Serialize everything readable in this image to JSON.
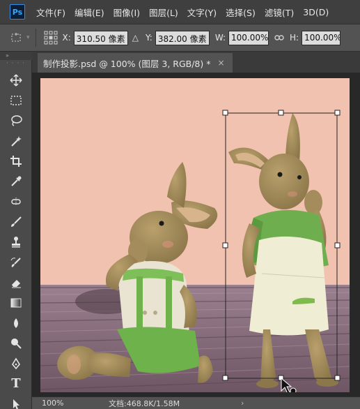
{
  "app": {
    "logo": "Ps"
  },
  "menu": [
    "文件(F)",
    "编辑(E)",
    "图像(I)",
    "图层(L)",
    "文字(Y)",
    "选择(S)",
    "滤镜(T)",
    "3D(D)"
  ],
  "options": {
    "x_label": "X:",
    "x_value": "310.50 像素",
    "delta_icon": "△",
    "y_label": "Y:",
    "y_value": "382.00 像素",
    "w_label": "W:",
    "w_value": "100.00%",
    "link_icon": "chain-link-icon",
    "h_label": "H:",
    "h_value": "100.00%"
  },
  "document": {
    "tab_title": "制作投影.psd @ 100% (图层 3, RGB/8) *",
    "close": "×"
  },
  "tools": [
    "move-icon",
    "marquee-icon",
    "lasso-icon",
    "magic-wand-icon",
    "crop-icon",
    "eyedropper-icon",
    "healing-brush-icon",
    "brush-icon",
    "clone-stamp-icon",
    "history-brush-icon",
    "eraser-icon",
    "gradient-icon",
    "blur-icon",
    "dodge-icon",
    "pen-icon",
    "type-icon",
    "path-select-icon"
  ],
  "status": {
    "zoom": "100%",
    "doc_size": "文档:468.8K/1.58M",
    "arrow": "›"
  },
  "colors": {
    "canvas_wall": "#f2c2b0",
    "floor": "#8a6f7e",
    "transform_box": "#222222",
    "accent": "#31a8ff"
  }
}
